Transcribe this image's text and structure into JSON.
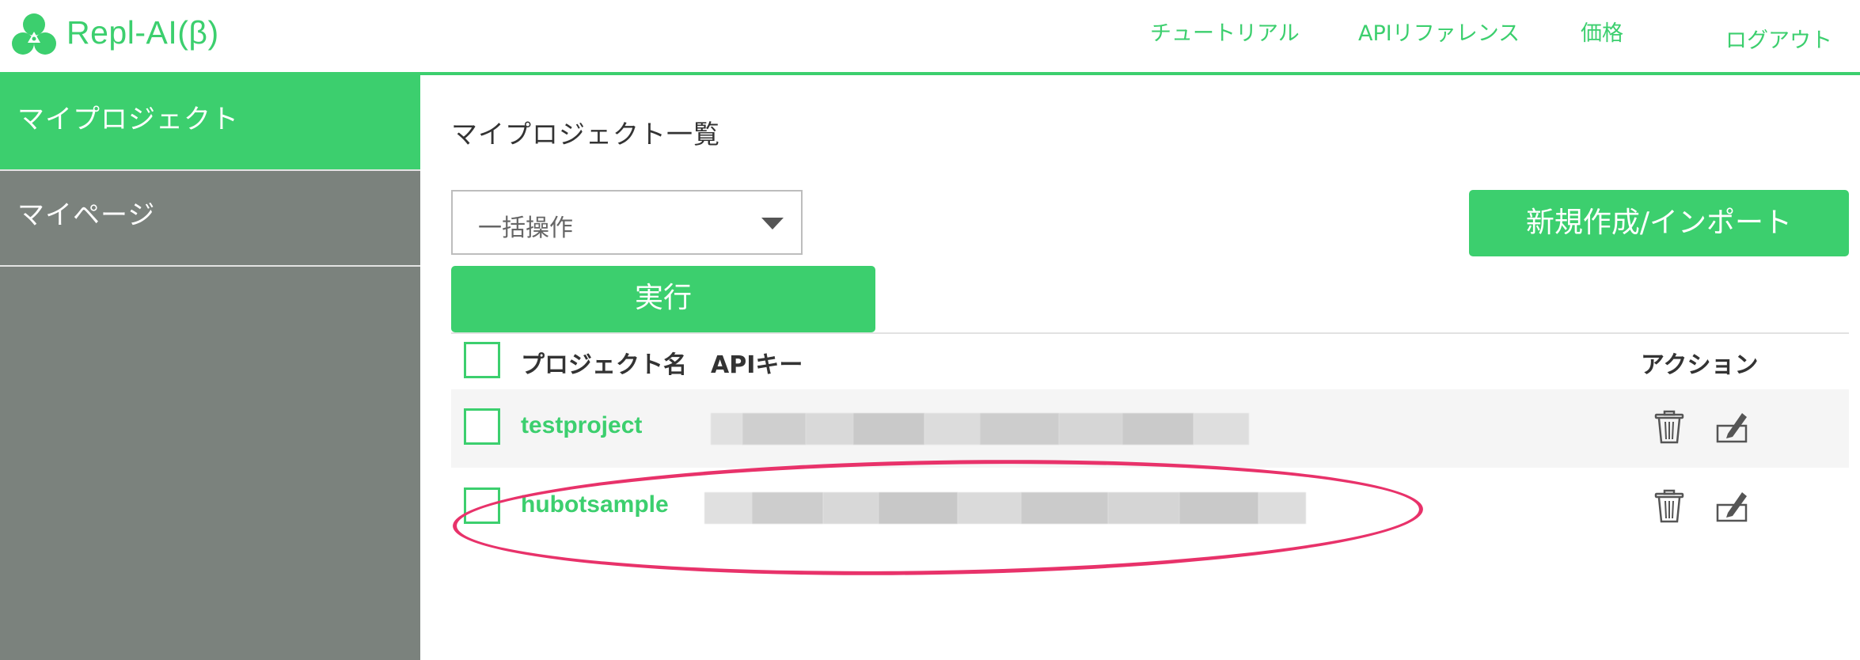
{
  "app": {
    "brand": "Repl-AI(β)",
    "brand_color": "#3ccf6e"
  },
  "nav": {
    "tutorial": "チュートリアル",
    "api_reference": "APIリファレンス",
    "pricing": "価格",
    "logout": "ログアウト"
  },
  "sidebar": {
    "items": [
      {
        "label": "マイプロジェクト",
        "active": true
      },
      {
        "label": "マイページ",
        "active": false
      }
    ]
  },
  "main": {
    "title": "マイプロジェクト一覧",
    "bulk_action": {
      "selected": "一括操作"
    },
    "new_button": "新規作成/インポート",
    "run_button": "実行"
  },
  "table": {
    "headers": {
      "project_name": "プロジェクト名",
      "api_key": "APIキー",
      "actions": "アクション"
    },
    "rows": [
      {
        "name": "testproject",
        "api_key_obscured": true,
        "actions": [
          "trash-icon",
          "edit-icon"
        ]
      },
      {
        "name": "hubotsample",
        "api_key_obscured": true,
        "actions": [
          "trash-icon",
          "edit-icon"
        ]
      }
    ]
  },
  "annotation": {
    "highlight_color": "#e8326a"
  }
}
